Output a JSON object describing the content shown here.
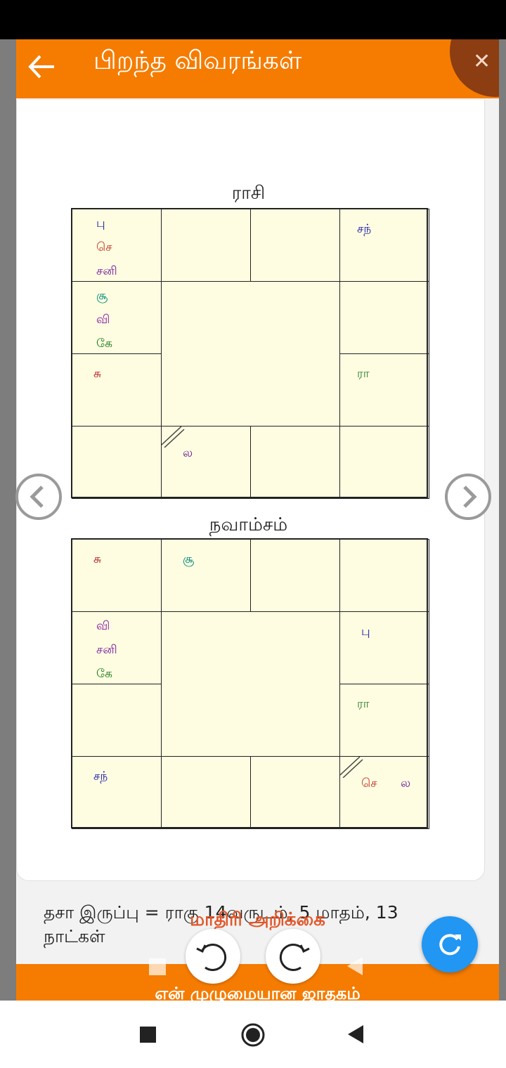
{
  "header": {
    "title": "பிறந்த விவரங்கள்"
  },
  "rasi": {
    "title": "ராசி",
    "planets": {
      "c0": [
        "பு",
        "செ",
        "சனி"
      ],
      "c4": [
        "சூ",
        "வி",
        "கே"
      ],
      "c6": [
        "சு"
      ],
      "c3": [
        "சந்"
      ],
      "c7": [
        "ரா"
      ],
      "c9": [
        "ல"
      ]
    }
  },
  "navamsam": {
    "title": "நவாம்சம்",
    "planets": {
      "c0": [
        "சு"
      ],
      "c1": [
        "சூ"
      ],
      "c4": [
        "வி",
        "சனி",
        "கே"
      ],
      "c5": [
        "பு"
      ],
      "c7": [
        "ரா"
      ],
      "c8": [
        "சந்"
      ],
      "c11": [
        "செ",
        "ல"
      ]
    }
  },
  "planet_colors": {
    "பு": "#1a1aa8",
    "செ": "#c0392b",
    "சனி": "#7b1fa2",
    "சூ": "#00897b",
    "வி": "#8e24aa",
    "கே": "#1b7a1b",
    "சு": "#b5121b",
    "சந்": "#1a1aa8",
    "ரா": "#2e7d32",
    "ல": "#6a1b9a"
  },
  "dasha": {
    "text": "தசா இருப்பு = ராகு 14வருடம், 5 மாதம், 13 நாட்கள்"
  },
  "footer": {
    "report_label": "மாதிரி அறிக்கை",
    "bottom_label": "என் முழுமையான ஜாதகம்"
  },
  "icons": {
    "back": "arrow-left-icon",
    "close": "close-icon",
    "prev": "chevron-left-icon",
    "next": "chevron-right-icon",
    "refresh": "refresh-icon",
    "rotate_left": "rotate-left-icon",
    "rotate_right": "rotate-right-icon"
  },
  "colors": {
    "accent": "#f57c00",
    "chart_bg": "#fffde1",
    "fab": "#2196f3"
  }
}
